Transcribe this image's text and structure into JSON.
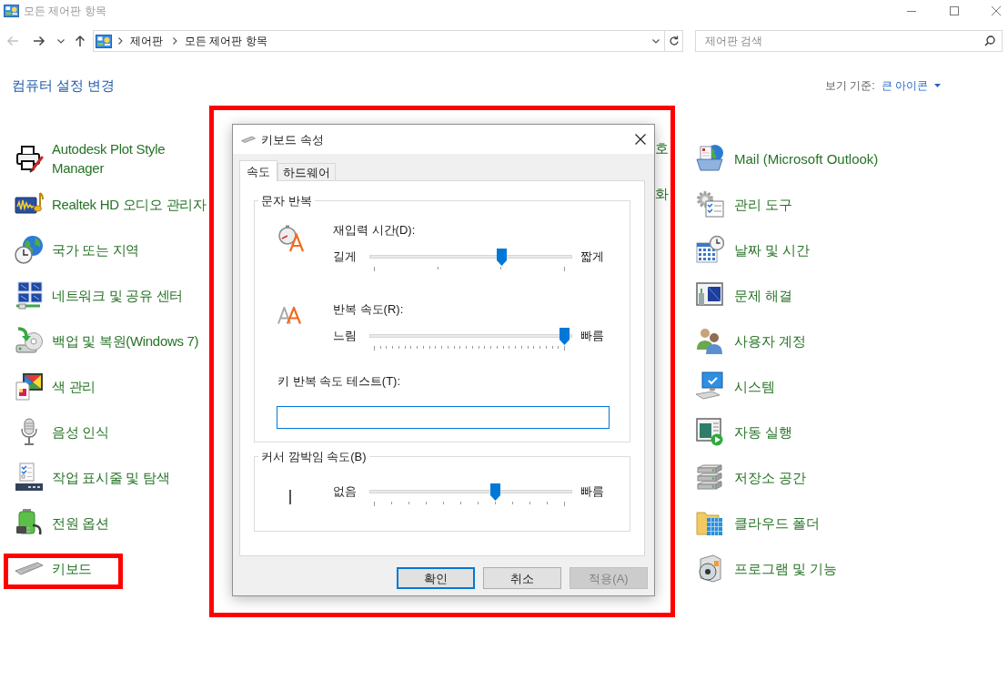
{
  "window": {
    "title": "모든 제어판 항목"
  },
  "address_bar": {
    "path": [
      "제어판",
      "모든 제어판 항목"
    ]
  },
  "search": {
    "placeholder": "제어판 검색"
  },
  "header": {
    "title": "컴퓨터 설정 변경",
    "view_label": "보기 기준:",
    "view_value": "큰 아이콘"
  },
  "items": {
    "column_1": [
      {
        "label": "Autodesk Plot Style Manager",
        "highlighted": false
      },
      {
        "label": "Realtek HD 오디오 관리자",
        "highlighted": false
      },
      {
        "label": "국가 또는 지역",
        "highlighted": false
      },
      {
        "label": "네트워크 및 공유 센터",
        "highlighted": false
      },
      {
        "label": "백업 및 복원(Windows 7)",
        "highlighted": false
      },
      {
        "label": "색 관리",
        "highlighted": false
      },
      {
        "label": "음성 인식",
        "highlighted": false
      },
      {
        "label": "작업 표시줄 및 탐색",
        "highlighted": false
      },
      {
        "label": "전원 옵션",
        "highlighted": false
      },
      {
        "label": "키보드",
        "highlighted": true
      }
    ],
    "column_2": [
      {
        "label": "호"
      },
      {
        "label": "화"
      }
    ],
    "column_3": [
      {
        "label": "Mail (Microsoft Outlook)"
      },
      {
        "label": "관리 도구"
      },
      {
        "label": "날짜 및 시간"
      },
      {
        "label": "문제 해결"
      },
      {
        "label": "사용자 계정"
      },
      {
        "label": "시스템"
      },
      {
        "label": "자동 실행"
      },
      {
        "label": "저장소 공간"
      },
      {
        "label": "클라우드 폴더"
      },
      {
        "label": "프로그램 및 기능"
      }
    ]
  },
  "dialog": {
    "title": "키보드 속성",
    "highlighted": true,
    "tabs": [
      {
        "label": "속도",
        "selected": true
      },
      {
        "label": "하드웨어",
        "selected": false
      }
    ],
    "groups": [
      {
        "title": "문자 반복",
        "sliders": [
          {
            "label": "재입력 시간(D):",
            "min_label": "길게",
            "max_label": "짧게",
            "level": 0.67
          },
          {
            "label": "반복 속도(R):",
            "min_label": "느림",
            "max_label": "빠름",
            "level": 1
          }
        ],
        "test_label": "키 반복 속도 테스트(T):"
      },
      {
        "title": "커서 깜박임 속도(B)",
        "sliders": [
          {
            "min_label": "없음",
            "max_label": "빠름",
            "level": 0.64
          }
        ]
      }
    ],
    "buttons": [
      {
        "label": "확인",
        "focused": true,
        "disabled": false
      },
      {
        "label": "취소",
        "focused": false,
        "disabled": false
      },
      {
        "label": "적용(A)",
        "focused": false,
        "disabled": true
      }
    ]
  }
}
